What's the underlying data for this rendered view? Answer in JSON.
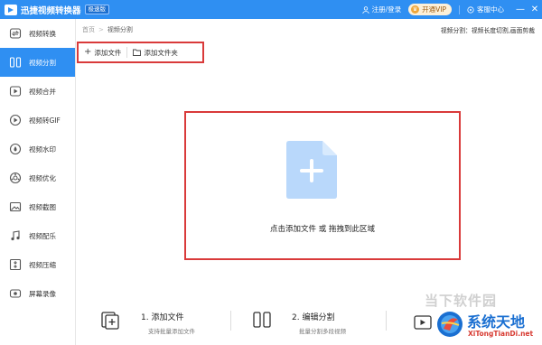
{
  "app": {
    "title": "迅捷视频转换器",
    "badge": "极速版",
    "login": "注册/登录",
    "vip": "开通VIP",
    "help": "客服中心",
    "minimize": "—",
    "close": "✕"
  },
  "sidebar": {
    "items": [
      {
        "label": "视频转换",
        "icon": "video-convert-icon",
        "active": false
      },
      {
        "label": "视频分割",
        "icon": "video-split-icon",
        "active": true
      },
      {
        "label": "视频合并",
        "icon": "video-merge-icon",
        "active": false
      },
      {
        "label": "视频转GIF",
        "icon": "gif-icon",
        "active": false
      },
      {
        "label": "视频水印",
        "icon": "watermark-icon",
        "active": false
      },
      {
        "label": "视频优化",
        "icon": "optimize-icon",
        "active": false
      },
      {
        "label": "视频截图",
        "icon": "screenshot-icon",
        "active": false
      },
      {
        "label": "视频配乐",
        "icon": "music-icon",
        "active": false
      },
      {
        "label": "视频压缩",
        "icon": "compress-icon",
        "active": false
      },
      {
        "label": "屏幕录像",
        "icon": "screen-record-icon",
        "active": false
      }
    ]
  },
  "breadcrumb": {
    "home": "首页",
    "separator": ">",
    "current": "视频分割",
    "description": "视频分割：视频长度切割,画面剪裁"
  },
  "toolbar": {
    "add_file": "添加文件",
    "add_folder": "添加文件夹"
  },
  "dropzone": {
    "text": "点击添加文件 或 拖拽到此区域"
  },
  "steps": [
    {
      "title": "1. 添加文件",
      "desc": "支持批量添加文件"
    },
    {
      "title": "2. 编辑分割",
      "desc": "批量分割多段视频"
    }
  ],
  "watermark": {
    "cn_text": "当下软件园",
    "name": "系统天地",
    "url": "XiTongTianDi.net"
  },
  "colors": {
    "accent": "#2f8ff2",
    "highlight_box": "#d93a3a",
    "file_icon": "#b9d8fb"
  }
}
